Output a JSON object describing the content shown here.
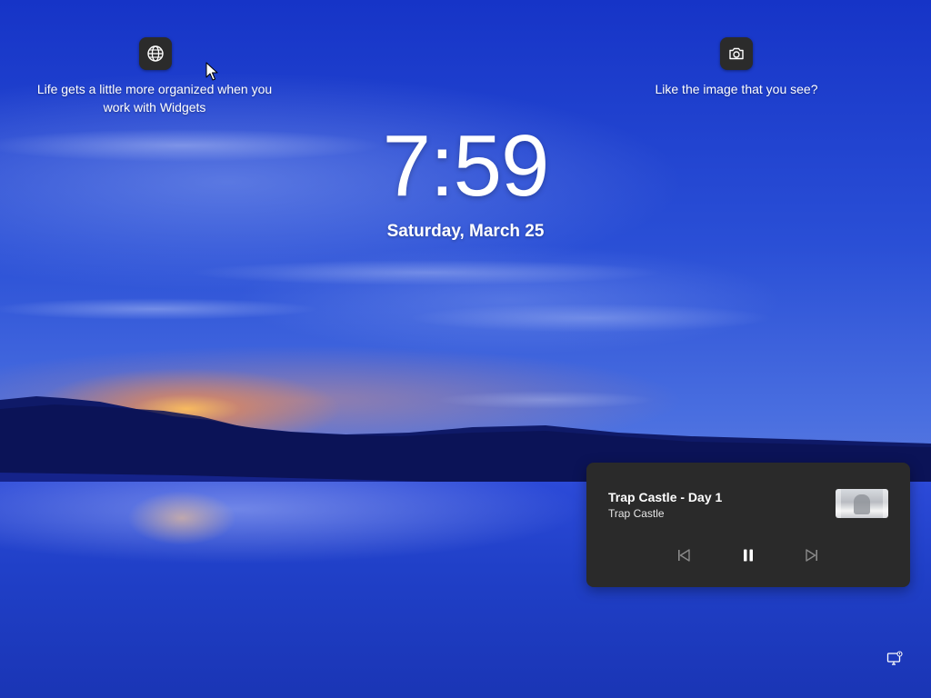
{
  "widgets": {
    "icon": "globe-icon",
    "text": "Life gets a little more organized when you work with Widgets"
  },
  "spotlight": {
    "icon": "camera-icon",
    "text": "Like the image that you see?"
  },
  "clock": {
    "time": "7:59",
    "date": "Saturday, March 25"
  },
  "media": {
    "title": "Trap Castle - Day 1",
    "artist": "Trap Castle",
    "controls": {
      "previous_icon": "skip-previous-icon",
      "play_pause_icon": "pause-icon",
      "next_icon": "skip-next-icon"
    }
  },
  "tray": {
    "network_icon": "network-icon"
  },
  "colors": {
    "card_bg": "#2a2a2a",
    "button_bg": "#2b2b2b"
  }
}
